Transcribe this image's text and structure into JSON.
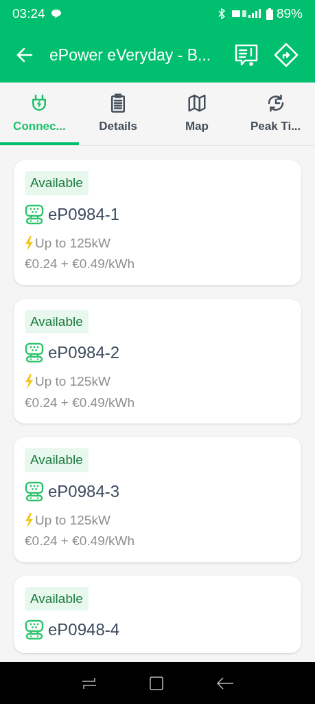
{
  "status_bar": {
    "time": "03:24",
    "battery": "89%"
  },
  "app_bar": {
    "title": "ePower eVeryday - B..."
  },
  "tabs": [
    {
      "label": "Connec...",
      "selected": true,
      "kind": "plug"
    },
    {
      "label": "Details",
      "selected": false,
      "kind": "clipboard"
    },
    {
      "label": "Map",
      "selected": false,
      "kind": "map"
    },
    {
      "label": "Peak Ti...",
      "selected": false,
      "kind": "clock"
    }
  ],
  "connectors": [
    {
      "status": "Available",
      "name": "eP0984-1",
      "power": "Up to 125kW",
      "price": "€0.24 + €0.49/kWh"
    },
    {
      "status": "Available",
      "name": "eP0984-2",
      "power": "Up to 125kW",
      "price": "€0.24 + €0.49/kWh"
    },
    {
      "status": "Available",
      "name": "eP0984-3",
      "power": "Up to 125kW",
      "price": "€0.24 + €0.49/kWh"
    },
    {
      "status": "Available",
      "name": "eP0948-4"
    }
  ]
}
